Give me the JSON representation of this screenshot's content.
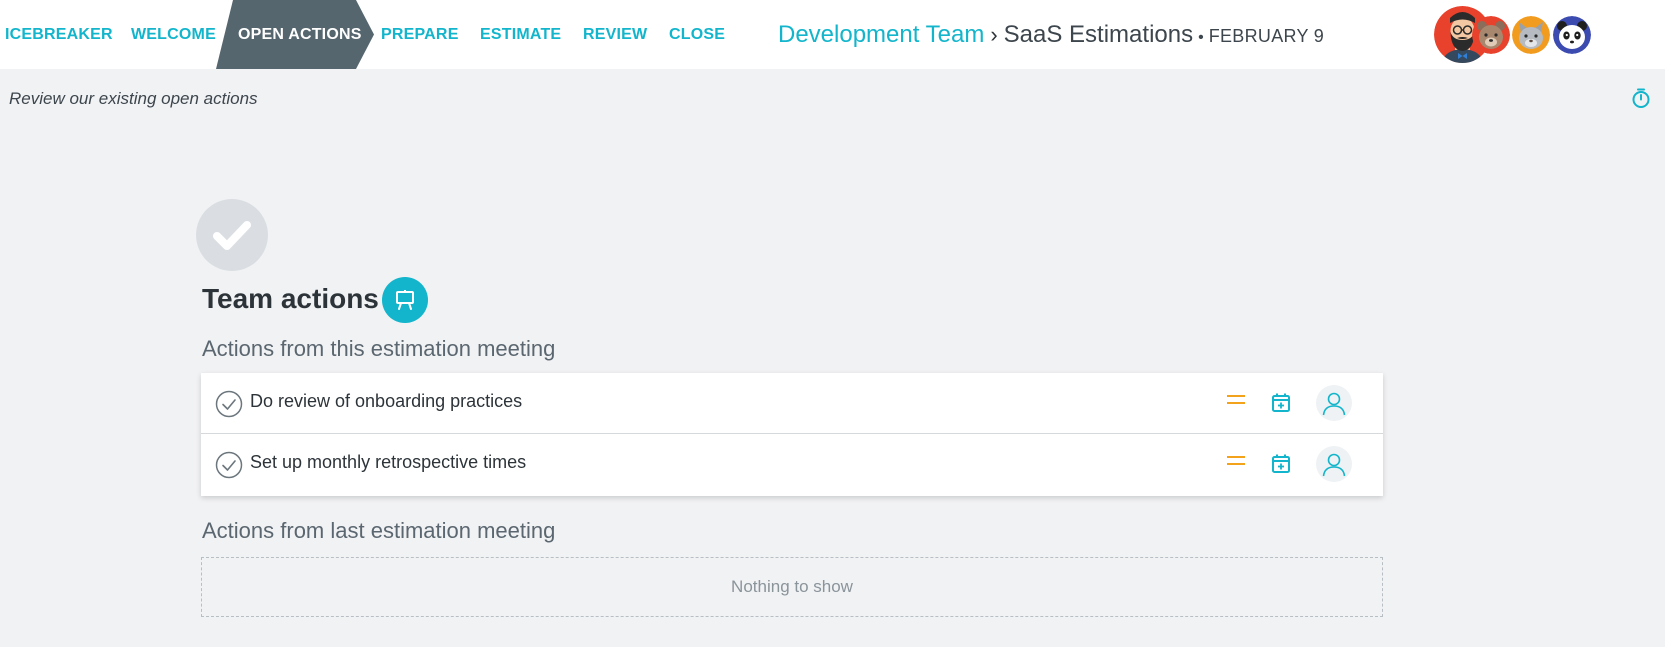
{
  "nav": {
    "steps": [
      {
        "label": "ICEBREAKER"
      },
      {
        "label": "WELCOME"
      },
      {
        "label": "OPEN ACTIONS"
      },
      {
        "label": "PREPARE"
      },
      {
        "label": "ESTIMATE"
      },
      {
        "label": "REVIEW"
      },
      {
        "label": "CLOSE"
      }
    ],
    "active_step": "OPEN ACTIONS"
  },
  "breadcrumb": {
    "team": "Development Team",
    "separator": "›",
    "meeting": "SaaS Estimations",
    "dot": "•",
    "date": "FEBRUARY 9"
  },
  "subheader": {
    "text": "Review our existing open actions"
  },
  "main": {
    "title": "Team actions",
    "current_group": {
      "title": "Actions from this estimation meeting",
      "actions": [
        {
          "text": "Do review of onboarding practices"
        },
        {
          "text": "Set up monthly retrospective times"
        }
      ]
    },
    "previous_group": {
      "title": "Actions from last estimation meeting",
      "empty_text": "Nothing to show"
    }
  },
  "colors": {
    "accent": "#12b5cb",
    "active_step_bg": "#56666f",
    "priority": "#f2a31b",
    "page_bg": "#f1f2f4"
  },
  "icons": [
    "facilitator-avatar",
    "bear-avatar",
    "cat-avatar",
    "panda-avatar",
    "timer-icon",
    "checkmark-icon",
    "presentation-icon",
    "check-circle-icon",
    "priority-medium-icon",
    "calendar-add-icon",
    "user-icon"
  ]
}
